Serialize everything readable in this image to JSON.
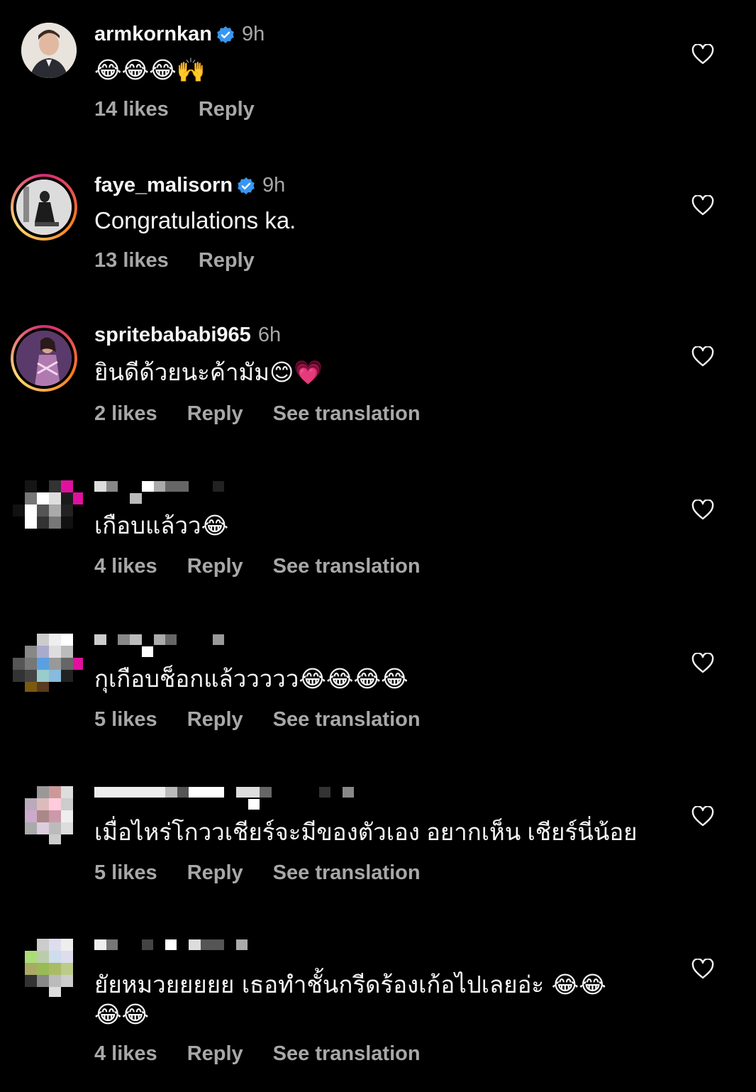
{
  "colors": {
    "background": "#000000",
    "text": "#f5f5f5",
    "muted": "#a8a8a8",
    "verified": "#3897f0"
  },
  "comments": [
    {
      "username": "armkornkan",
      "verified": true,
      "time": "9h",
      "text": "😂😂😂🙌",
      "likes": "14 likes",
      "reply": "Reply"
    },
    {
      "username": "faye_malisorn",
      "verified": true,
      "time": "9h",
      "text": "Congratulations ka.",
      "likes": "13 likes",
      "reply": "Reply"
    },
    {
      "username": "spritebababi965",
      "verified": false,
      "time": "6h",
      "text": "ยินดีด้วยนะค้ามัม😊💗",
      "likes": "2 likes",
      "reply": "Reply",
      "translate": "See translation"
    },
    {
      "text": "เกือบแล้วว😂",
      "likes": "4 likes",
      "reply": "Reply",
      "translate": "See translation"
    },
    {
      "text": "กุเกือบช็อกแล้ววววว😂😂😂😂",
      "likes": "5 likes",
      "reply": "Reply",
      "translate": "See translation"
    },
    {
      "text": "เมื่อไหร่โกววเชียร์จะมีของตัวเอง อยากเห็น เชียร์นี่น้อย",
      "likes": "5 likes",
      "reply": "Reply",
      "translate": "See translation"
    },
    {
      "text": "ยัยหมวยยยยย เธอทำชั้นกรีดร้องเก้อไปเลยอ่ะ 😂😂",
      "text2": "😂😂",
      "likes": "4 likes",
      "reply": "Reply",
      "translate": "See translation"
    }
  ],
  "icons": {
    "like": "heart-outline-icon",
    "verified": "verified-badge-icon"
  }
}
